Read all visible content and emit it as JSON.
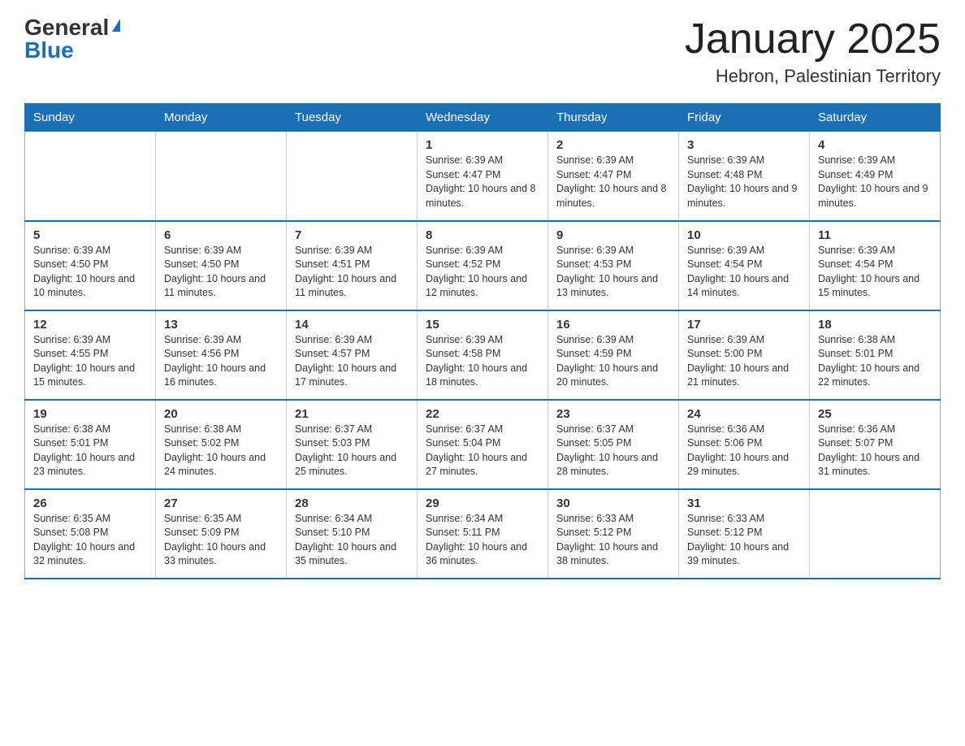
{
  "header": {
    "logo_general": "General",
    "logo_blue": "Blue",
    "month_title": "January 2025",
    "location": "Hebron, Palestinian Territory"
  },
  "days_of_week": [
    "Sunday",
    "Monday",
    "Tuesday",
    "Wednesday",
    "Thursday",
    "Friday",
    "Saturday"
  ],
  "weeks": [
    [
      {
        "day": "",
        "info": ""
      },
      {
        "day": "",
        "info": ""
      },
      {
        "day": "",
        "info": ""
      },
      {
        "day": "1",
        "info": "Sunrise: 6:39 AM\nSunset: 4:47 PM\nDaylight: 10 hours and 8 minutes."
      },
      {
        "day": "2",
        "info": "Sunrise: 6:39 AM\nSunset: 4:47 PM\nDaylight: 10 hours and 8 minutes."
      },
      {
        "day": "3",
        "info": "Sunrise: 6:39 AM\nSunset: 4:48 PM\nDaylight: 10 hours and 9 minutes."
      },
      {
        "day": "4",
        "info": "Sunrise: 6:39 AM\nSunset: 4:49 PM\nDaylight: 10 hours and 9 minutes."
      }
    ],
    [
      {
        "day": "5",
        "info": "Sunrise: 6:39 AM\nSunset: 4:50 PM\nDaylight: 10 hours and 10 minutes."
      },
      {
        "day": "6",
        "info": "Sunrise: 6:39 AM\nSunset: 4:50 PM\nDaylight: 10 hours and 11 minutes."
      },
      {
        "day": "7",
        "info": "Sunrise: 6:39 AM\nSunset: 4:51 PM\nDaylight: 10 hours and 11 minutes."
      },
      {
        "day": "8",
        "info": "Sunrise: 6:39 AM\nSunset: 4:52 PM\nDaylight: 10 hours and 12 minutes."
      },
      {
        "day": "9",
        "info": "Sunrise: 6:39 AM\nSunset: 4:53 PM\nDaylight: 10 hours and 13 minutes."
      },
      {
        "day": "10",
        "info": "Sunrise: 6:39 AM\nSunset: 4:54 PM\nDaylight: 10 hours and 14 minutes."
      },
      {
        "day": "11",
        "info": "Sunrise: 6:39 AM\nSunset: 4:54 PM\nDaylight: 10 hours and 15 minutes."
      }
    ],
    [
      {
        "day": "12",
        "info": "Sunrise: 6:39 AM\nSunset: 4:55 PM\nDaylight: 10 hours and 15 minutes."
      },
      {
        "day": "13",
        "info": "Sunrise: 6:39 AM\nSunset: 4:56 PM\nDaylight: 10 hours and 16 minutes."
      },
      {
        "day": "14",
        "info": "Sunrise: 6:39 AM\nSunset: 4:57 PM\nDaylight: 10 hours and 17 minutes."
      },
      {
        "day": "15",
        "info": "Sunrise: 6:39 AM\nSunset: 4:58 PM\nDaylight: 10 hours and 18 minutes."
      },
      {
        "day": "16",
        "info": "Sunrise: 6:39 AM\nSunset: 4:59 PM\nDaylight: 10 hours and 20 minutes."
      },
      {
        "day": "17",
        "info": "Sunrise: 6:39 AM\nSunset: 5:00 PM\nDaylight: 10 hours and 21 minutes."
      },
      {
        "day": "18",
        "info": "Sunrise: 6:38 AM\nSunset: 5:01 PM\nDaylight: 10 hours and 22 minutes."
      }
    ],
    [
      {
        "day": "19",
        "info": "Sunrise: 6:38 AM\nSunset: 5:01 PM\nDaylight: 10 hours and 23 minutes."
      },
      {
        "day": "20",
        "info": "Sunrise: 6:38 AM\nSunset: 5:02 PM\nDaylight: 10 hours and 24 minutes."
      },
      {
        "day": "21",
        "info": "Sunrise: 6:37 AM\nSunset: 5:03 PM\nDaylight: 10 hours and 25 minutes."
      },
      {
        "day": "22",
        "info": "Sunrise: 6:37 AM\nSunset: 5:04 PM\nDaylight: 10 hours and 27 minutes."
      },
      {
        "day": "23",
        "info": "Sunrise: 6:37 AM\nSunset: 5:05 PM\nDaylight: 10 hours and 28 minutes."
      },
      {
        "day": "24",
        "info": "Sunrise: 6:36 AM\nSunset: 5:06 PM\nDaylight: 10 hours and 29 minutes."
      },
      {
        "day": "25",
        "info": "Sunrise: 6:36 AM\nSunset: 5:07 PM\nDaylight: 10 hours and 31 minutes."
      }
    ],
    [
      {
        "day": "26",
        "info": "Sunrise: 6:35 AM\nSunset: 5:08 PM\nDaylight: 10 hours and 32 minutes."
      },
      {
        "day": "27",
        "info": "Sunrise: 6:35 AM\nSunset: 5:09 PM\nDaylight: 10 hours and 33 minutes."
      },
      {
        "day": "28",
        "info": "Sunrise: 6:34 AM\nSunset: 5:10 PM\nDaylight: 10 hours and 35 minutes."
      },
      {
        "day": "29",
        "info": "Sunrise: 6:34 AM\nSunset: 5:11 PM\nDaylight: 10 hours and 36 minutes."
      },
      {
        "day": "30",
        "info": "Sunrise: 6:33 AM\nSunset: 5:12 PM\nDaylight: 10 hours and 38 minutes."
      },
      {
        "day": "31",
        "info": "Sunrise: 6:33 AM\nSunset: 5:12 PM\nDaylight: 10 hours and 39 minutes."
      },
      {
        "day": "",
        "info": ""
      }
    ]
  ]
}
